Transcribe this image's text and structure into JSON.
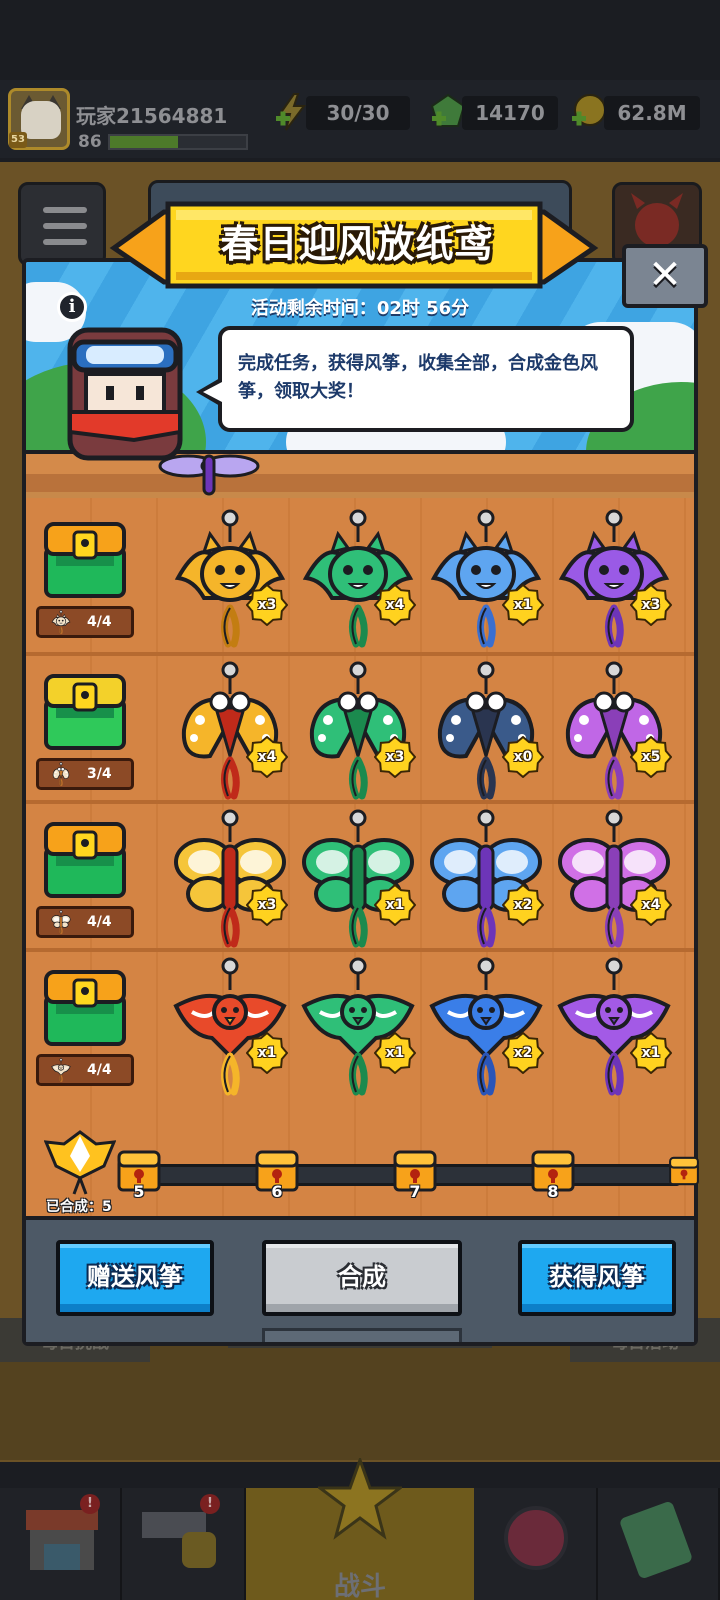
{
  "status_bar": {
    "player_name": "玩家21564881",
    "player_level": "86",
    "avatar_level": "53",
    "xp_fraction": 0.5,
    "energy": "30/30",
    "gems": "14170",
    "coins": "62.8M"
  },
  "background": {
    "daily_challenge": "每日挑战",
    "daily_event": "每日活动",
    "nav_battle": "战斗",
    "shop_badge": "!",
    "weapon_badge": "!"
  },
  "event": {
    "title": "春日迎风放纸鸢",
    "timer_label": "活动剩余时间：",
    "timer_value": "02时 56分",
    "info_glyph": "i",
    "close_glyph": "✕",
    "description": "完成任务，获得风筝，收集全部，合成金色风筝，领取大奖！",
    "rows": [
      {
        "progress": "4/4",
        "chest_color": "#1fb85a",
        "chest_lid": "#f7a21a",
        "kites": [
          {
            "count": "x3",
            "type": "cat",
            "color": "#f5b52a",
            "dark": "#c37d12"
          },
          {
            "count": "x4",
            "type": "cat",
            "color": "#2fbf78",
            "dark": "#1b8a4e"
          },
          {
            "count": "x1",
            "type": "cat",
            "color": "#5ea5f0",
            "dark": "#3a6fd0"
          },
          {
            "count": "x3",
            "type": "cat",
            "color": "#9a5ae6",
            "dark": "#6d35b8"
          }
        ]
      },
      {
        "progress": "3/4",
        "chest_color": "#2fc95a",
        "chest_lid": "#f3d12a",
        "kites": [
          {
            "count": "x4",
            "type": "moth",
            "color": "#f5b52a",
            "dark": "#c02a1a"
          },
          {
            "count": "x3",
            "type": "moth",
            "color": "#2fbf78",
            "dark": "#1b8a4e"
          },
          {
            "count": "x0",
            "type": "moth",
            "color": "#3a5a8a",
            "dark": "#2a3550"
          },
          {
            "count": "x5",
            "type": "moth",
            "color": "#c067e6",
            "dark": "#8a3fb8"
          }
        ]
      },
      {
        "progress": "4/4",
        "chest_color": "#1fb85a",
        "chest_lid": "#f7a21a",
        "kites": [
          {
            "count": "x3",
            "type": "butterfly",
            "color": "#f5c53a",
            "dark": "#c02a1a"
          },
          {
            "count": "x1",
            "type": "butterfly",
            "color": "#2fbf78",
            "dark": "#1b8a4e"
          },
          {
            "count": "x2",
            "type": "butterfly",
            "color": "#5ea5f0",
            "dark": "#6d35b8"
          },
          {
            "count": "x4",
            "type": "butterfly",
            "color": "#d070e6",
            "dark": "#8a3fb8"
          }
        ]
      },
      {
        "progress": "4/4",
        "chest_color": "#1fb85a",
        "chest_lid": "#f7a21a",
        "kites": [
          {
            "count": "x1",
            "type": "bird",
            "color": "#e84a2a",
            "dark": "#f5b52a"
          },
          {
            "count": "x1",
            "type": "bird",
            "color": "#2fbf78",
            "dark": "#1b8a4e"
          },
          {
            "count": "x2",
            "type": "bird",
            "color": "#3a7ee8",
            "dark": "#2a55b8"
          },
          {
            "count": "x1",
            "type": "bird",
            "color": "#a35ae6",
            "dark": "#6d35b8"
          }
        ]
      }
    ],
    "milestones": [
      "5",
      "6",
      "7",
      "8",
      ""
    ],
    "merged_label": "已合成：5",
    "buttons": {
      "gift": "赠送风筝",
      "merge": "合成",
      "obtain": "获得风筝"
    }
  },
  "colors": {
    "title_yellow": "#ffd61f",
    "title_arrow": "#f7a21a",
    "button_blue": "#1ea8f0",
    "badge_yellow": "#ffd21f"
  }
}
